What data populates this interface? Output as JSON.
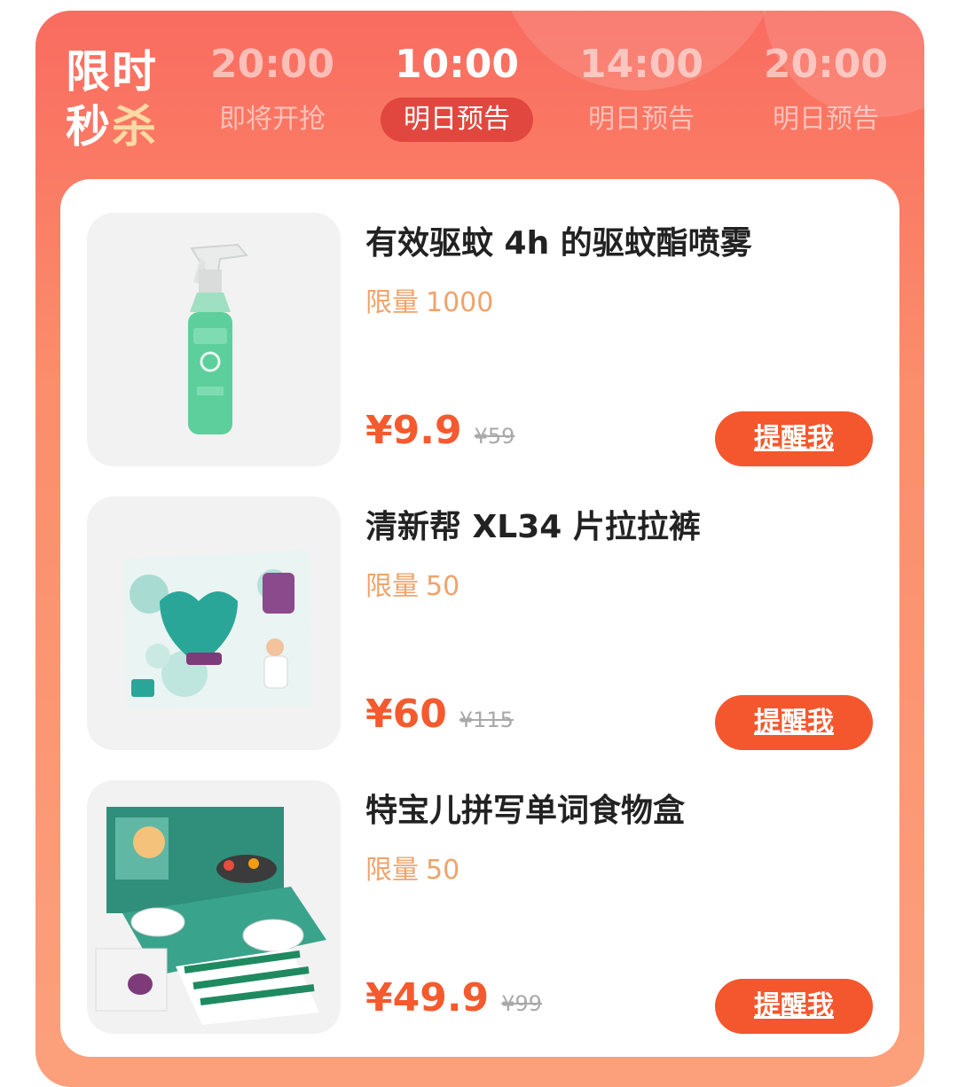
{
  "header": {
    "title_line1": "限时",
    "title_line2_a": "秒",
    "title_line2_b": "杀",
    "tabs": [
      {
        "time": "20:00",
        "label": "即将开抢"
      },
      {
        "time": "10:00",
        "label": "明日预告"
      },
      {
        "time": "14:00",
        "label": "明日预告"
      },
      {
        "time": "20:00",
        "label": "明日预告"
      }
    ]
  },
  "products": [
    {
      "name": "有效驱蚊 4h 的驱蚊酯喷雾",
      "limit_prefix": "限量",
      "limit": "1000",
      "price": "¥9.9",
      "original_price": "¥59",
      "button": "提醒我",
      "image": "mosquito-spray-bottle"
    },
    {
      "name": "清新帮 XL34 片拉拉裤",
      "limit_prefix": "限量",
      "limit": "50",
      "price": "¥60",
      "original_price": "¥115",
      "button": "提醒我",
      "image": "pampers-diaper-pack"
    },
    {
      "name": "特宝儿拼写单词食物盒",
      "limit_prefix": "限量",
      "limit": "50",
      "price": "¥49.9",
      "original_price": "¥99",
      "button": "提醒我",
      "image": "spelling-food-toy-box"
    }
  ],
  "colors": {
    "header_gradient_top": "#f96c60",
    "active_tab_bg": "#e1473e",
    "price": "#f45a2e",
    "button": "#f4572d",
    "limit_text": "#f0a36a"
  }
}
